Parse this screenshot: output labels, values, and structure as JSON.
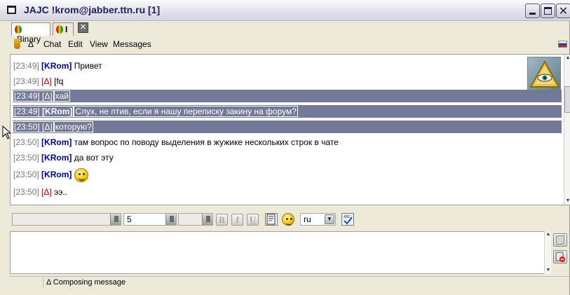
{
  "window": {
    "title": "JAJC !krom@jabber.ttn.ru [1]"
  },
  "tabs": [
    {
      "label": "Binary",
      "icon": "balloon-icon"
    },
    {
      "label": "I",
      "icon": "balloon-icon"
    }
  ],
  "menu": {
    "first_label": "Δ",
    "items": [
      "Chat",
      "Edit",
      "View",
      "Messages"
    ]
  },
  "messages": [
    {
      "time": "[23:49]",
      "nick": "[KRom]",
      "text": "Привет",
      "selected": false
    },
    {
      "time": "[23:49]",
      "nick": "[Δ]",
      "text": "[fq",
      "selected": false
    },
    {
      "time": "[23:49]",
      "nick": "[Δ]",
      "text": "хай",
      "selected": true
    },
    {
      "time": "[23:49]",
      "nick": "[KRom]",
      "text": "Слух, не птив, если я нашу переписку закину на форум?",
      "selected": true
    },
    {
      "time": "[23:50]",
      "nick": "[Δ]",
      "text": "которую?",
      "selected": true
    },
    {
      "time": "[23:50]",
      "nick": "[KRom]",
      "text": "там вопрос по поводу выделения в жужике нескольких строк в чате",
      "selected": false
    },
    {
      "time": "[23:50]",
      "nick": "[KRom]",
      "text": "да вот эту",
      "selected": false
    },
    {
      "time": "[23:50]",
      "nick": "[KRom]",
      "text": "",
      "selected": false
    },
    {
      "time": "[23:50]",
      "nick": "[Δ]",
      "text": "ээ..",
      "selected": false
    }
  ],
  "format_toolbar": {
    "font_value": "",
    "size_value": "5",
    "color_value": "",
    "bold": "B",
    "italic": "I",
    "underline": "U",
    "language": "ru"
  },
  "input": {
    "value": ""
  },
  "status": {
    "text": "Δ Composing message"
  }
}
